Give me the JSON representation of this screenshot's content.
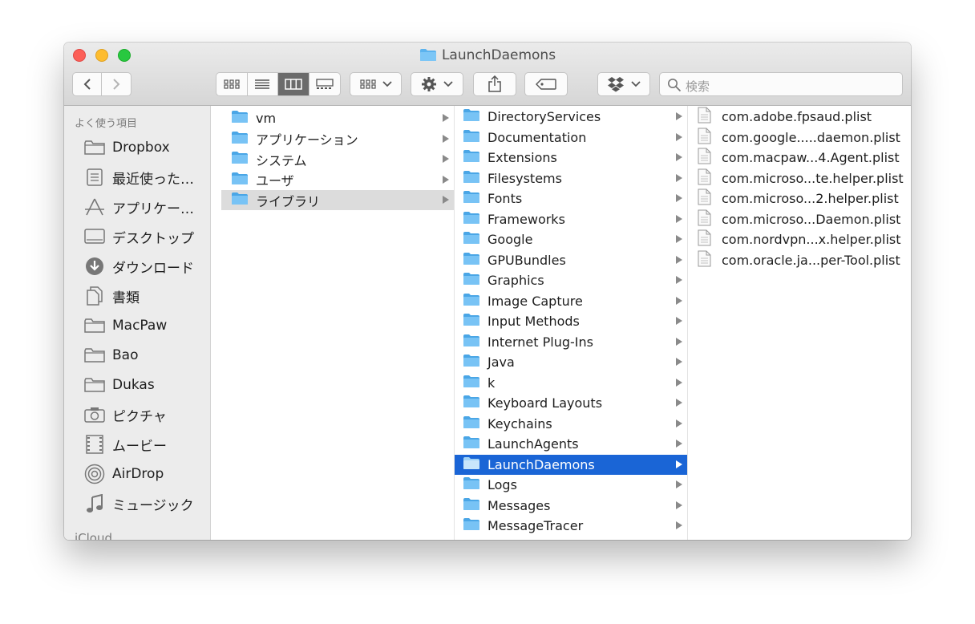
{
  "window": {
    "title": "LaunchDaemons"
  },
  "toolbar": {
    "search_placeholder": "検索"
  },
  "sidebar": {
    "favorites_header": "よく使う項目",
    "items": [
      {
        "label": "Dropbox",
        "icon": "folder-icon"
      },
      {
        "label": "最近使った…",
        "icon": "recents-icon"
      },
      {
        "label": "アプリケー…",
        "icon": "applications-icon"
      },
      {
        "label": "デスクトップ",
        "icon": "desktop-icon"
      },
      {
        "label": "ダウンロード",
        "icon": "download-icon"
      },
      {
        "label": "書類",
        "icon": "documents-icon"
      },
      {
        "label": "MacPaw",
        "icon": "folder-icon"
      },
      {
        "label": "Bao",
        "icon": "folder-icon"
      },
      {
        "label": "Dukas",
        "icon": "folder-icon"
      },
      {
        "label": "ピクチャ",
        "icon": "camera-icon"
      },
      {
        "label": "ムービー",
        "icon": "film-icon"
      },
      {
        "label": "AirDrop",
        "icon": "airdrop-icon"
      },
      {
        "label": "ミュージック",
        "icon": "music-icon"
      }
    ],
    "icloud_header": "iCloud"
  },
  "column1": [
    {
      "label": "vm"
    },
    {
      "label": "アプリケーション"
    },
    {
      "label": "システム"
    },
    {
      "label": "ユーザ"
    },
    {
      "label": "ライブラリ",
      "selected": true
    }
  ],
  "column2": [
    "DirectoryServices",
    "Documentation",
    "Extensions",
    "Filesystems",
    "Fonts",
    "Frameworks",
    "Google",
    "GPUBundles",
    "Graphics",
    "Image Capture",
    "Input Methods",
    "Internet Plug-Ins",
    "Java",
    "k",
    "Keyboard Layouts",
    "Keychains",
    "LaunchAgents",
    "LaunchDaemons",
    "Logs",
    "Messages",
    "MessageTracer"
  ],
  "column2_selected": "LaunchDaemons",
  "column3": [
    "com.adobe.fpsaud.plist",
    "com.google.....daemon.plist",
    "com.macpaw...4.Agent.plist",
    "com.microso...te.helper.plist",
    "com.microso...2.helper.plist",
    "com.microso...Daemon.plist",
    "com.nordvpn...x.helper.plist",
    "com.oracle.ja...per-Tool.plist"
  ],
  "colors": {
    "selection_blue": "#1a65d6",
    "folder_blue": "#5bb3ee"
  }
}
